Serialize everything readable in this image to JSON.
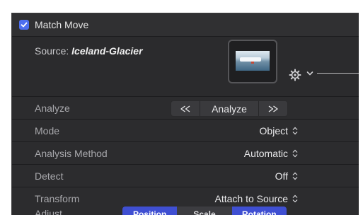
{
  "header": {
    "title": "Match Move",
    "checked": true,
    "accent": "#4d6ff0"
  },
  "source": {
    "prefix": "Source: ",
    "name": "Iceland-Glacier",
    "thumbnail": "glacier-lake-thumbnail",
    "gear_icon": "gear-icon",
    "menu_icon": "chevron-down-icon"
  },
  "rows": {
    "analyze": {
      "label": "Analyze",
      "button": "Analyze",
      "back_icon": "rewind-icon",
      "forward_icon": "fast-forward-icon"
    },
    "mode": {
      "label": "Mode",
      "value": "Object"
    },
    "method": {
      "label": "Analysis Method",
      "value": "Automatic"
    },
    "detect": {
      "label": "Detect",
      "value": "Off"
    },
    "transform": {
      "label": "Transform",
      "value": "Attach to Source"
    },
    "adjust": {
      "label": "Adjust",
      "options": [
        {
          "label": "Position",
          "selected": true
        },
        {
          "label": "Scale",
          "selected": false
        },
        {
          "label": "Rotation",
          "selected": true
        }
      ],
      "selected_color": "#3f4fd2"
    }
  }
}
